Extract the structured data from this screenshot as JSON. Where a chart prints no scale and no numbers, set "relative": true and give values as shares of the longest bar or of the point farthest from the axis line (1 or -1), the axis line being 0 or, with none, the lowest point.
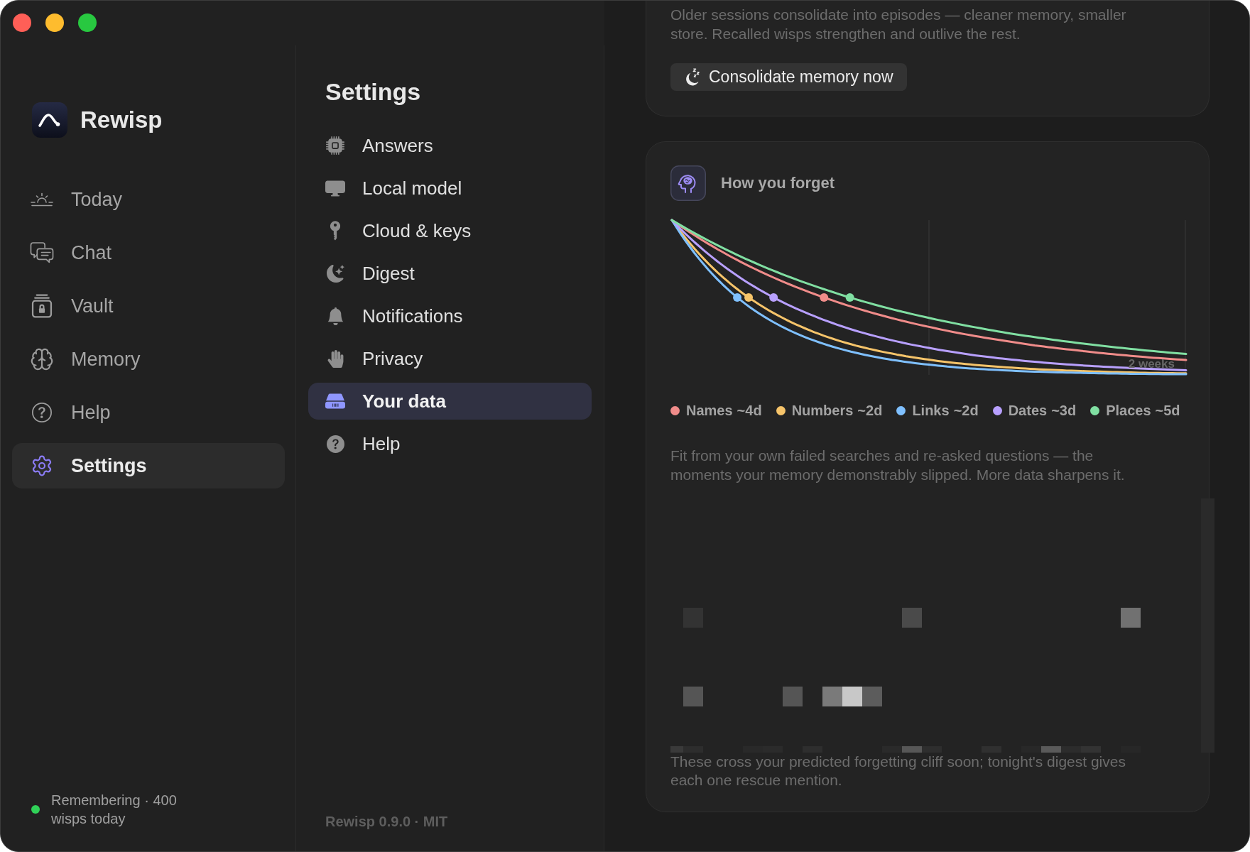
{
  "window": {
    "controls": [
      {
        "kind": "close"
      },
      {
        "kind": "minimize"
      },
      {
        "kind": "zoom"
      }
    ]
  },
  "sidebar": {
    "app_name": "Rewisp",
    "items": [
      {
        "label": "Today",
        "selected": false
      },
      {
        "label": "Chat",
        "selected": false
      },
      {
        "label": "Vault",
        "selected": false
      },
      {
        "label": "Memory",
        "selected": false
      },
      {
        "label": "Help",
        "selected": false
      },
      {
        "label": "Settings",
        "selected": true
      }
    ],
    "status": {
      "text": "Remembering · 400 wisps today",
      "active": true
    }
  },
  "settings_nav": {
    "title": "Settings",
    "items": [
      {
        "label": "Answers",
        "selected": false
      },
      {
        "label": "Local model",
        "selected": false
      },
      {
        "label": "Cloud & keys",
        "selected": false
      },
      {
        "label": "Digest",
        "selected": false
      },
      {
        "label": "Notifications",
        "selected": false
      },
      {
        "label": "Privacy",
        "selected": false
      },
      {
        "label": "Your data",
        "selected": true
      },
      {
        "label": "Help",
        "selected": false
      }
    ],
    "version": "Rewisp 0.9.0 · MIT"
  },
  "consolidate_card": {
    "description": "Older sessions consolidate into episodes — cleaner memory, smaller store. Recalled wisps strengthen and outlive the rest.",
    "button": "Consolidate memory now"
  },
  "forgetting_card": {
    "title": "How you forget",
    "chart_data": {
      "type": "line",
      "relative": true,
      "annotations": [
        {
          "text": "2 weeks"
        }
      ],
      "series": [
        {
          "name": "Names",
          "color": "#f08c8a",
          "values": [
            1,
            0.846,
            0.715,
            0.605,
            0.512,
            0.433,
            0.366,
            0.31,
            0.262,
            0.222,
            0.187,
            0.159,
            0.134,
            0.113,
            0.096
          ]
        },
        {
          "name": "Numbers",
          "color": "#f6c46a",
          "values": [
            1,
            0.718,
            0.515,
            0.37,
            0.265,
            0.19,
            0.137,
            0.098,
            0.07,
            0.051,
            0.036,
            0.026,
            0.019,
            0.013,
            0.01
          ]
        },
        {
          "name": "Links",
          "color": "#7fc0ff",
          "values": [
            1,
            0.678,
            0.459,
            0.311,
            0.211,
            0.143,
            0.097,
            0.066,
            0.044,
            0.03,
            0.02,
            0.014,
            0.009,
            0.006,
            0.004
          ]
        },
        {
          "name": "Dates",
          "color": "#b8a0ff",
          "values": [
            1,
            0.779,
            0.606,
            0.472,
            0.368,
            0.286,
            0.223,
            0.174,
            0.135,
            0.105,
            0.082,
            0.064,
            0.05,
            0.039,
            0.03
          ]
        },
        {
          "name": "Places",
          "color": "#80dfa2",
          "values": [
            1,
            0.867,
            0.751,
            0.651,
            0.565,
            0.489,
            0.424,
            0.368,
            0.319,
            0.276,
            0.24,
            0.208,
            0.18,
            0.156,
            0.135
          ]
        }
      ]
    },
    "half_lives": [
      "~4d",
      "~2d",
      "~2d",
      "~3d",
      "~5d"
    ],
    "note": "Fit from your own failed searches and re-asked questions — the moments your memory demonstrably slipped. More data sharpens it.",
    "footer": "These cross your predicted forgetting cliff soon; tonight's digest gives each one rescue mention."
  }
}
